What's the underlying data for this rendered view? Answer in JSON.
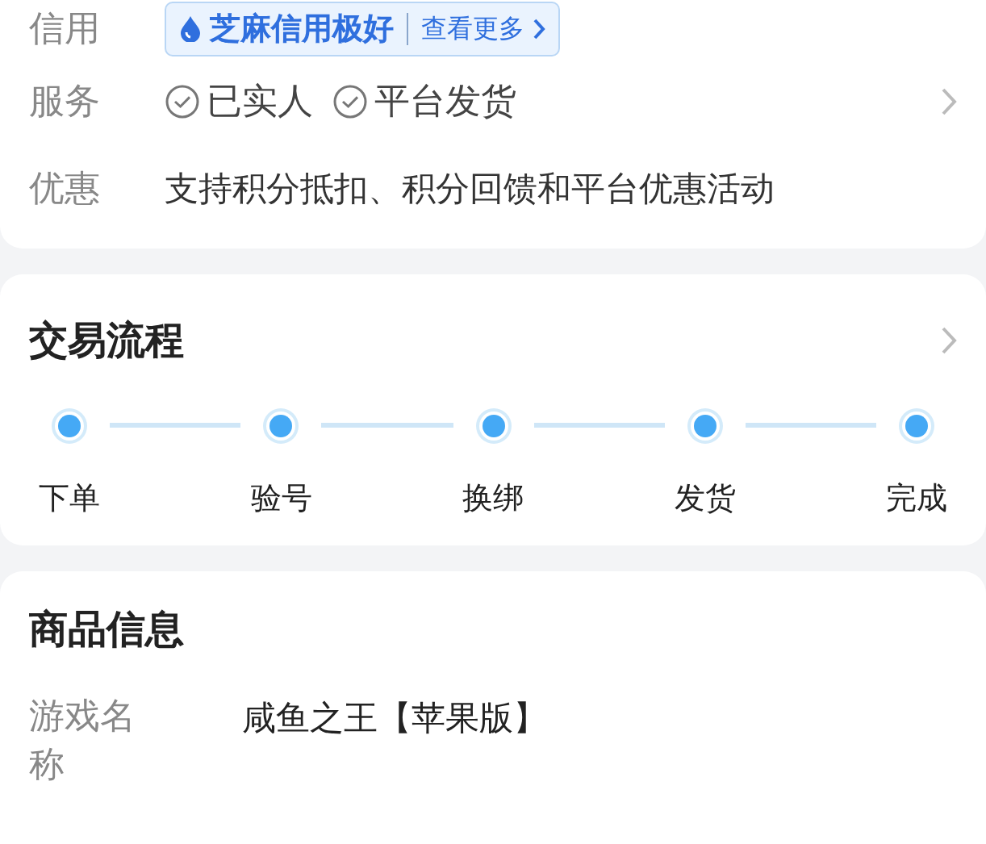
{
  "seller_info": {
    "credit": {
      "label": "信用",
      "badge": "芝麻信用极好",
      "link": "查看更多"
    },
    "services": {
      "label": "服务",
      "items": [
        "已实人",
        "平台发货"
      ]
    },
    "offers": {
      "label": "优惠",
      "text": "支持积分抵扣、积分回馈和平台优惠活动"
    }
  },
  "trade_flow": {
    "title": "交易流程",
    "steps": [
      "下单",
      "验号",
      "换绑",
      "发货",
      "完成"
    ]
  },
  "product_info": {
    "title": "商品信息",
    "fields": [
      {
        "label": "游戏名称",
        "value": "咸鱼之王【苹果版】"
      }
    ]
  }
}
